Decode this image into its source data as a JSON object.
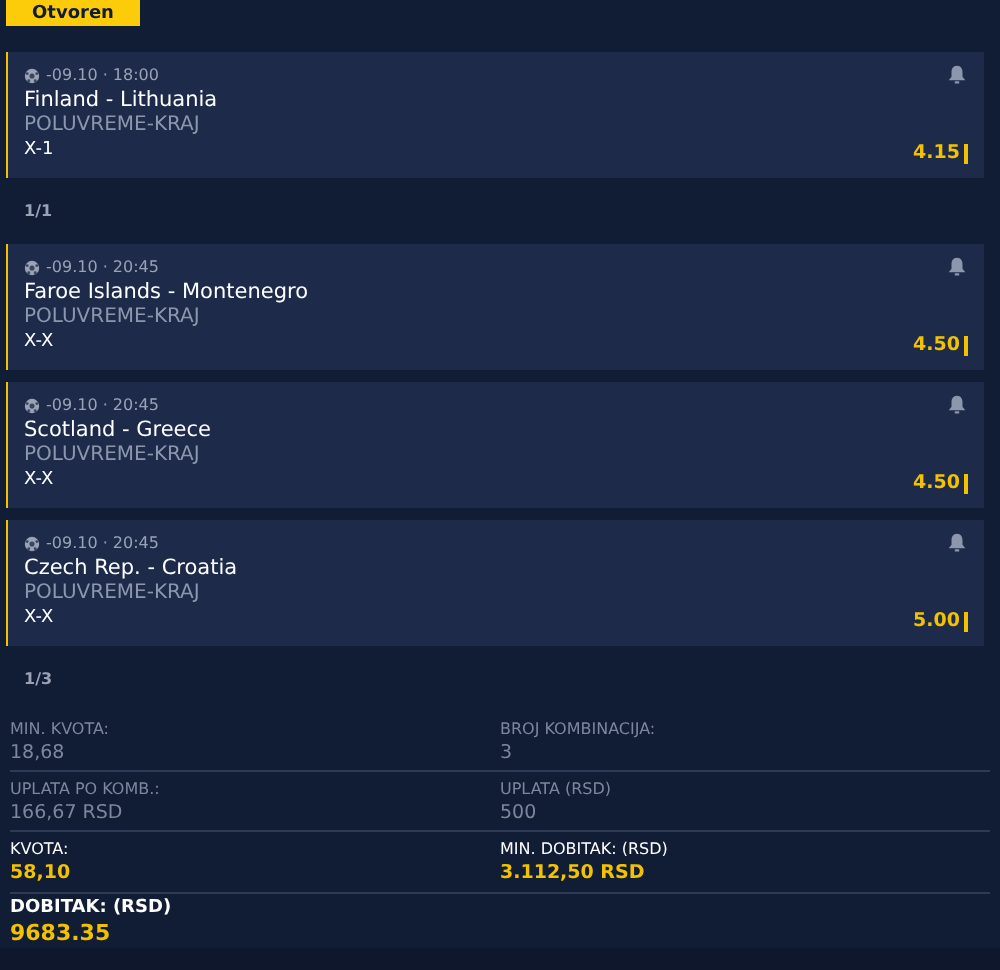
{
  "status_button": {
    "label": "Otvoren"
  },
  "groups": [
    {
      "events": [
        {
          "time": "-09.10 · 18:00",
          "teams": "Finland - Lithuania",
          "market": "POLUVREME-KRAJ",
          "pick": "X-1",
          "odds": "4.15"
        }
      ],
      "counter": "1/1"
    },
    {
      "events": [
        {
          "time": "-09.10 · 20:45",
          "teams": "Faroe Islands - Montenegro",
          "market": "POLUVREME-KRAJ",
          "pick": "X-X",
          "odds": "4.50"
        },
        {
          "time": "-09.10 · 20:45",
          "teams": "Scotland - Greece",
          "market": "POLUVREME-KRAJ",
          "pick": "X-X",
          "odds": "4.50"
        },
        {
          "time": "-09.10 · 20:45",
          "teams": "Czech Rep. - Croatia",
          "market": "POLUVREME-KRAJ",
          "pick": "X-X",
          "odds": "5.00"
        }
      ],
      "counter": "1/3"
    }
  ],
  "summary": [
    [
      {
        "label": "MIN. KVOTA:",
        "value": "18,68",
        "highlight": false
      },
      {
        "label": "BROJ KOMBINACIJA:",
        "value": "3",
        "highlight": false
      }
    ],
    [
      {
        "label": "UPLATA PO KOMB.:",
        "value": "166,67 RSD",
        "highlight": false
      },
      {
        "label": "UPLATA (RSD)",
        "value": "500",
        "highlight": false
      }
    ],
    [
      {
        "label": "KVOTA:",
        "value": "58,10",
        "highlight": true
      },
      {
        "label": "MIN. DOBITAK: (RSD)",
        "value": "3.112,50 RSD",
        "highlight": true
      }
    ]
  ],
  "payout": {
    "label": "DOBITAK: (RSD)",
    "value": "9683.35"
  }
}
